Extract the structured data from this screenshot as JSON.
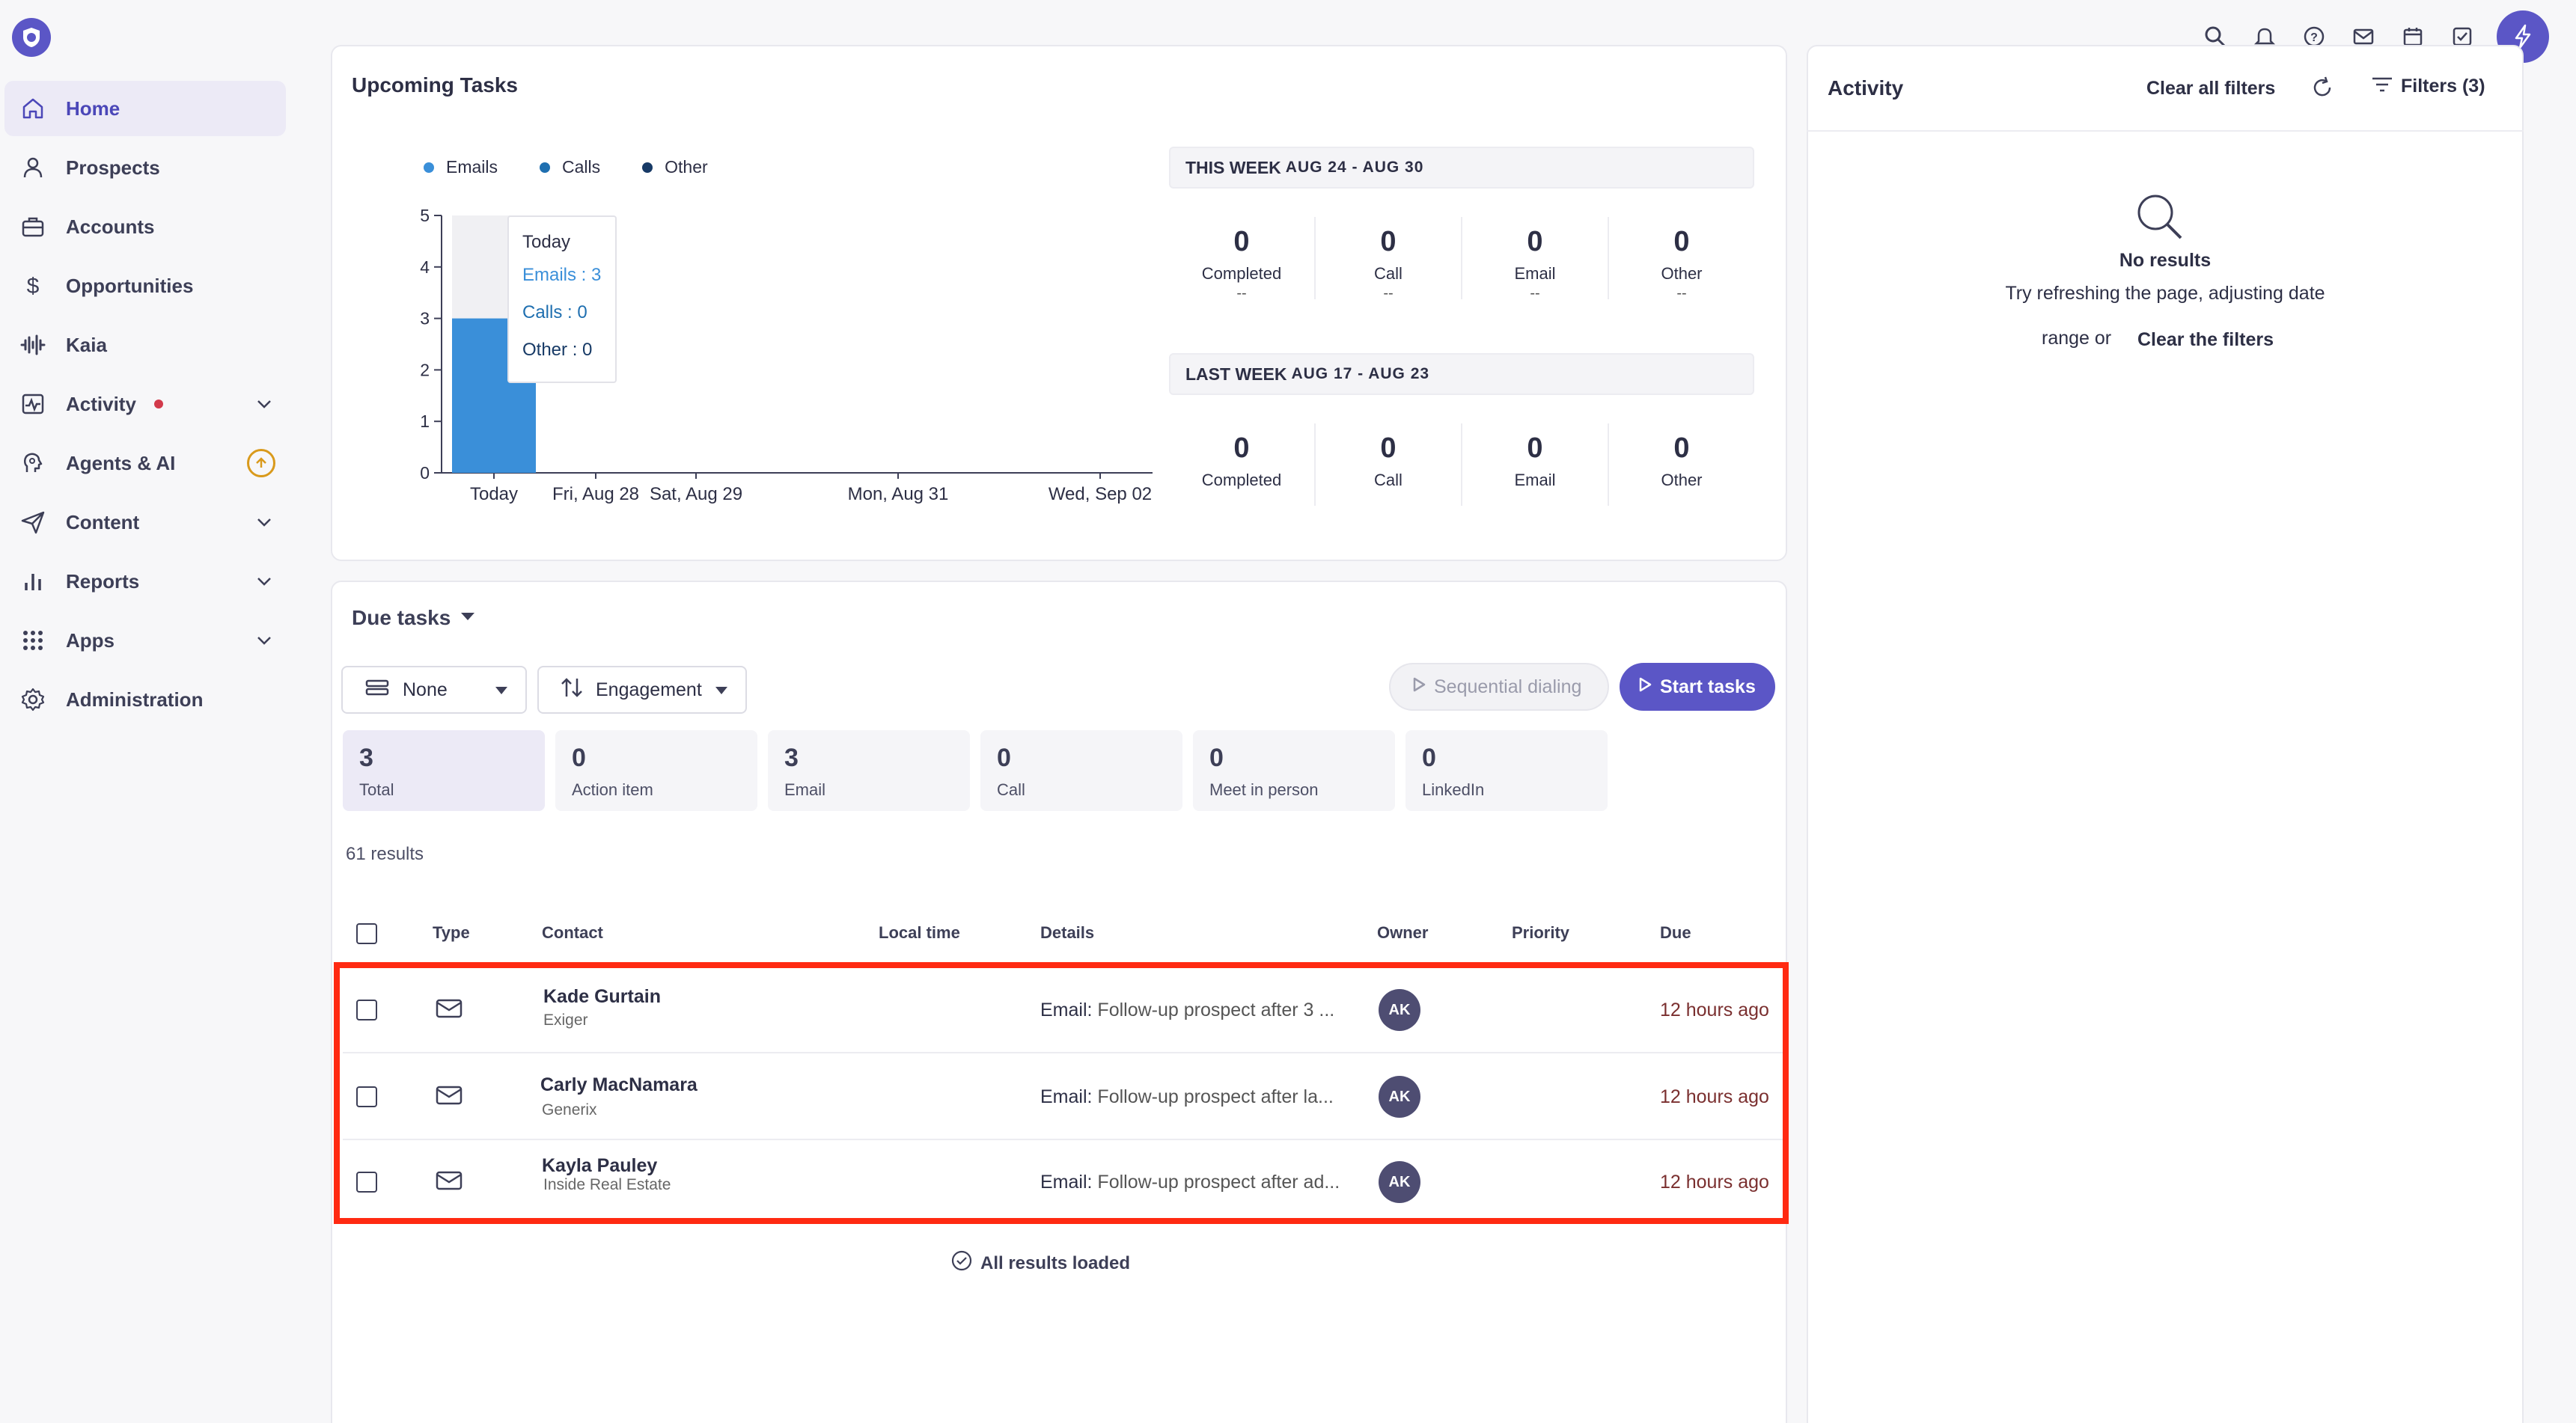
{
  "sidebar": {
    "items": [
      {
        "label": "Home",
        "icon": "home-icon"
      },
      {
        "label": "Prospects",
        "icon": "person-icon"
      },
      {
        "label": "Accounts",
        "icon": "briefcase-icon"
      },
      {
        "label": "Opportunities",
        "icon": "dollar-icon"
      },
      {
        "label": "Kaia",
        "icon": "waveform-icon"
      },
      {
        "label": "Activity",
        "icon": "activity-icon"
      },
      {
        "label": "Agents & AI",
        "icon": "agent-icon"
      },
      {
        "label": "Content",
        "icon": "send-icon"
      },
      {
        "label": "Reports",
        "icon": "bar-chart-icon"
      },
      {
        "label": "Apps",
        "icon": "grid-icon"
      },
      {
        "label": "Administration",
        "icon": "gear-icon"
      }
    ]
  },
  "upcoming": {
    "title": "Upcoming Tasks",
    "legend": [
      {
        "label": "Emails",
        "color": "#3a8fd9"
      },
      {
        "label": "Calls",
        "color": "#1f6fb0"
      },
      {
        "label": "Other",
        "color": "#173a66"
      }
    ],
    "tooltip": {
      "title": "Today",
      "emails": "Emails : 3",
      "calls": "Calls : 0",
      "other": "Other : 0"
    },
    "this_week": {
      "label": "THIS WEEK",
      "range": "AUG 24 - AUG 30",
      "stats": [
        {
          "num": "0",
          "label": "Completed",
          "sub": "--"
        },
        {
          "num": "0",
          "label": "Call",
          "sub": "--"
        },
        {
          "num": "0",
          "label": "Email",
          "sub": "--"
        },
        {
          "num": "0",
          "label": "Other",
          "sub": "--"
        }
      ]
    },
    "last_week": {
      "label": "LAST WEEK",
      "range": "AUG 17 - AUG 23",
      "stats": [
        {
          "num": "0",
          "label": "Completed"
        },
        {
          "num": "0",
          "label": "Call"
        },
        {
          "num": "0",
          "label": "Email"
        },
        {
          "num": "0",
          "label": "Other"
        }
      ]
    }
  },
  "chart_data": {
    "type": "bar",
    "categories": [
      "Today",
      "Fri, Aug 28",
      "Sat, Aug 29",
      "Mon, Aug 31",
      "Wed, Sep 02"
    ],
    "series": [
      {
        "name": "Emails",
        "values": [
          3,
          0,
          0,
          0,
          0
        ]
      },
      {
        "name": "Calls",
        "values": [
          0,
          0,
          0,
          0,
          0
        ]
      },
      {
        "name": "Other",
        "values": [
          0,
          0,
          0,
          0,
          0
        ]
      }
    ],
    "yticks": [
      "0",
      "1",
      "2",
      "3",
      "4",
      "5"
    ],
    "ylim": [
      0,
      5
    ],
    "legend_position": "top-left"
  },
  "due_tasks": {
    "title": "Due tasks",
    "group_by": "None",
    "sort_by": "Engagement",
    "sequential_label": "Sequential dialing",
    "start_label": "Start tasks",
    "counts": [
      {
        "n": "3",
        "t": "Total"
      },
      {
        "n": "0",
        "t": "Action item"
      },
      {
        "n": "3",
        "t": "Email"
      },
      {
        "n": "0",
        "t": "Call"
      },
      {
        "n": "0",
        "t": "Meet in person"
      },
      {
        "n": "0",
        "t": "LinkedIn"
      }
    ],
    "results": "61 results",
    "headers": {
      "type": "Type",
      "contact": "Contact",
      "local_time": "Local time",
      "details": "Details",
      "owner": "Owner",
      "priority": "Priority",
      "due": "Due"
    },
    "rows": [
      {
        "name": "Kade Gurtain",
        "company": "Exiger",
        "details_prefix": "Email:",
        "details": "Follow-up prospect after 3 ...",
        "owner": "AK",
        "due": "12 hours ago"
      },
      {
        "name": "Carly MacNamara",
        "company": "Generix",
        "details_prefix": "Email:",
        "details": "Follow-up prospect after la...",
        "owner": "AK",
        "due": "12 hours ago"
      },
      {
        "name": "Kayla Pauley",
        "company": "Inside Real Estate",
        "details_prefix": "Email:",
        "details": "Follow-up prospect after ad...",
        "owner": "AK",
        "due": "12 hours ago"
      }
    ],
    "all_loaded": "All results loaded"
  },
  "activity": {
    "title": "Activity",
    "clear_all": "Clear all filters",
    "filters": "Filters (3)",
    "no_results": "No results",
    "hint_line1": "Try refreshing the page, adjusting date",
    "hint_line2": "range or",
    "clear_filters": "Clear the filters"
  }
}
